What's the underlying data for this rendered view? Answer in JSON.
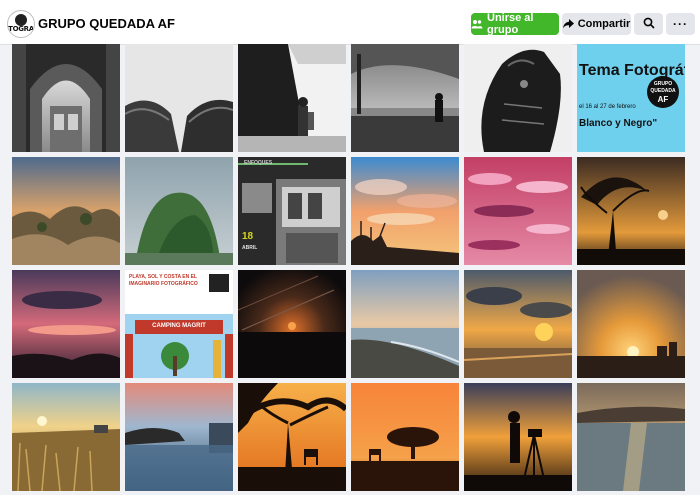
{
  "header": {
    "avatar_text": "TOGRA",
    "group_name": "GRUPO QUEDADA AF",
    "join_label": "Unirse al grupo",
    "share_label": "Compartir"
  },
  "icons": {
    "join": "people-icon",
    "share": "share-arrow-icon",
    "search": "search-icon",
    "more": "more-dots-icon"
  },
  "colors": {
    "join_bg": "#42b72a",
    "button_gray": "#e4e6eb",
    "page_bg": "#f0f2f5"
  },
  "poster": {
    "line1": "Tema Fotográfic",
    "line2": "el 16 al 27 de febrero",
    "line3": "Blanco y Negro\"",
    "badge_line1": "GRUPO",
    "badge_line2": "QUEDADA",
    "badge_line3": "AF"
  },
  "poster2": {
    "title": "ENFOQUES",
    "date_num": "18",
    "date_month": "ABRIL"
  },
  "poster3": {
    "line1": "PLAYA, SOL Y COSTA EN EL",
    "line2": "IMAGINARIO FOTOGRÁFICO",
    "sign": "CAMPING MAGRIT"
  },
  "thumbnails": [
    "arch-bw",
    "trees-bw",
    "building-bw",
    "harbor-bw",
    "horse-bw",
    "theme-poster",
    "rocks-sunset",
    "tree-mist",
    "exhibition-poster",
    "blue-clouds",
    "pink-clouds",
    "tree-silhouette-dusk",
    "pink-sunset-sea",
    "beach-poster",
    "orange-sunset",
    "beach-dusk",
    "sun-beach",
    "sunset-town",
    "golden-field",
    "rocky-sea",
    "acacia-sunset",
    "deer-sunset",
    "tripod-photographer",
    "coast-dusk"
  ]
}
